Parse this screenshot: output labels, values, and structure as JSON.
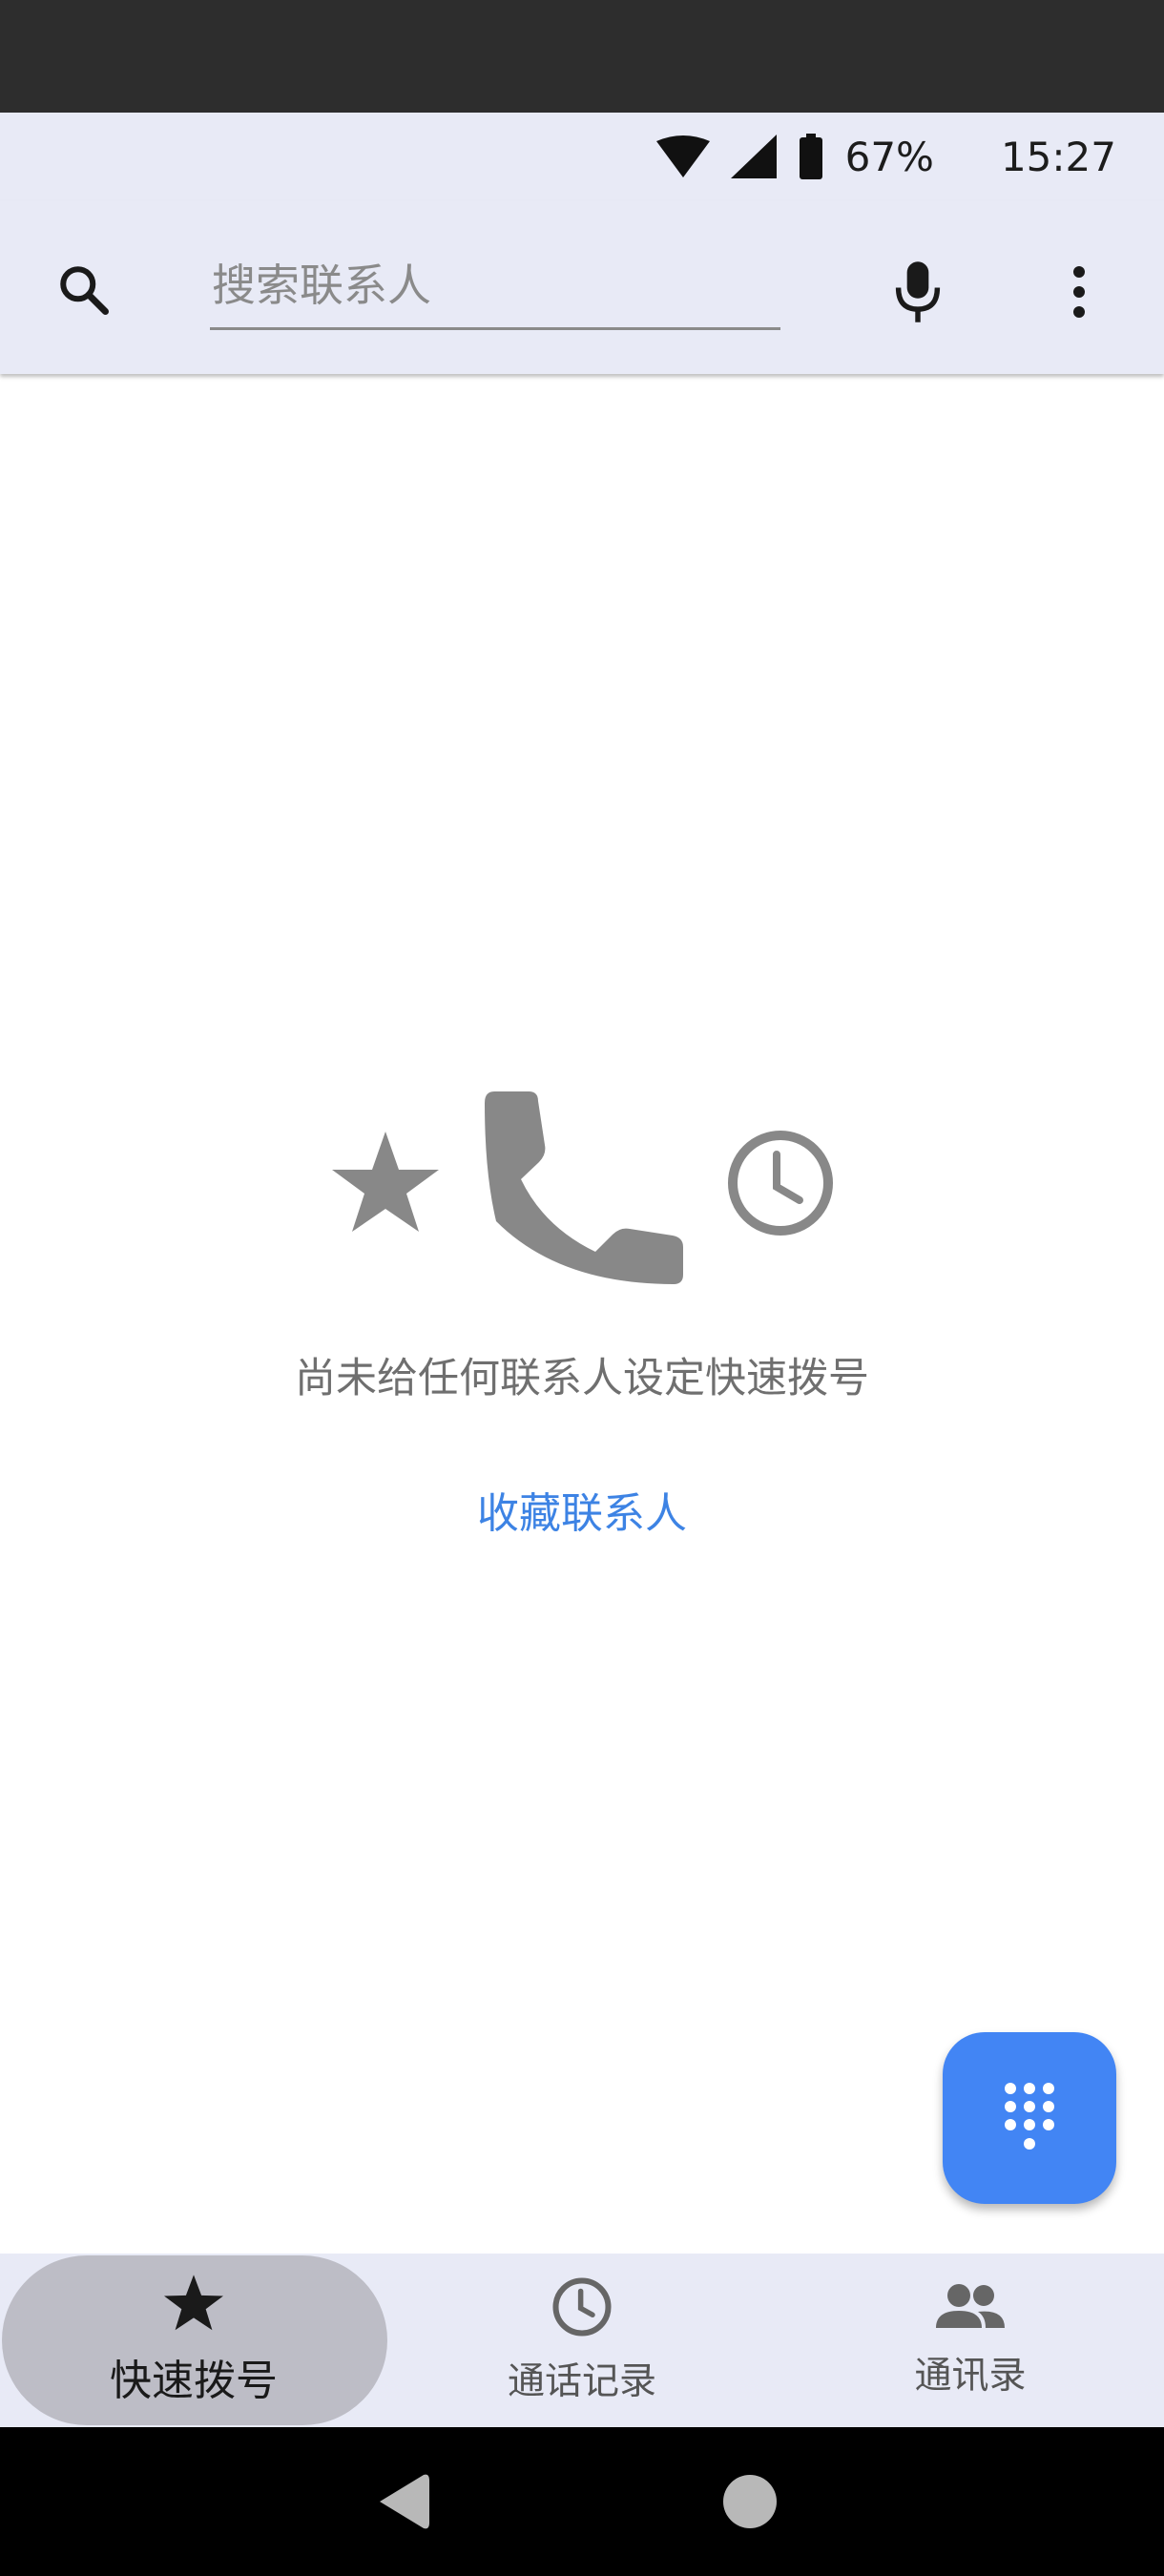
{
  "status_bar": {
    "battery_percent": "67%",
    "time": "15:27",
    "icons": [
      "wifi-icon",
      "cell-signal-icon",
      "battery-icon"
    ]
  },
  "search": {
    "placeholder": "搜索联系人",
    "value": "",
    "icons": [
      "search-icon",
      "mic-icon",
      "more-vert-icon"
    ]
  },
  "empty_state": {
    "icons": [
      "star-icon",
      "phone-icon",
      "clock-icon"
    ],
    "message": "尚未给任何联系人设定快速拨号",
    "action_label": "收藏联系人"
  },
  "fab": {
    "icon": "dialpad-icon"
  },
  "bottom_nav": {
    "items": [
      {
        "label": "快速拨号",
        "icon": "star-icon",
        "active": true
      },
      {
        "label": "通话记录",
        "icon": "clock-icon",
        "active": false
      },
      {
        "label": "通讯录",
        "icon": "people-icon",
        "active": false
      }
    ]
  },
  "system_nav": {
    "buttons": [
      "back-icon",
      "home-icon"
    ]
  },
  "colors": {
    "accent": "#4285f4",
    "link": "#3d83e4",
    "bar_background": "#e8eaf6",
    "active_pill": "#bdbdc6",
    "illustration_gray": "#888888"
  }
}
